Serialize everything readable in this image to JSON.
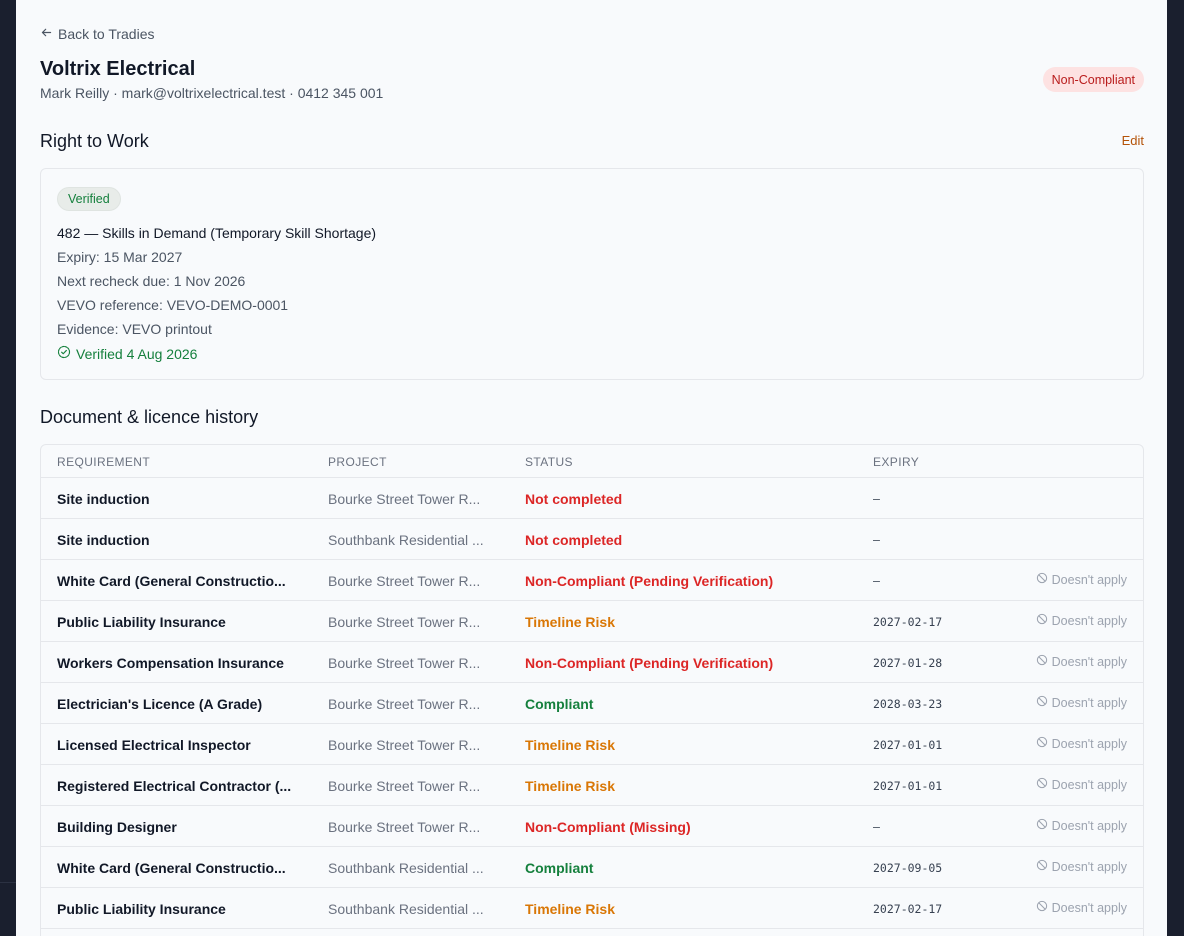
{
  "back_label": "Back to Tradies",
  "tradie": {
    "name": "Voltrix Electrical",
    "meta": "Mark Reilly · mark@voltrixelectrical.test · 0412 345 001",
    "status": "Non-Compliant"
  },
  "rtw": {
    "heading": "Right to Work",
    "edit_label": "Edit",
    "badge": "Verified",
    "visa": "482 — Skills in Demand (Temporary Skill Shortage)",
    "expiry": "Expiry: 15 Mar 2027",
    "recheck": "Next recheck due: 1 Nov 2026",
    "vevo_ref": "VEVO reference: VEVO-DEMO-0001",
    "evidence": "Evidence: VEVO printout",
    "verified_on": "Verified 4 Aug 2026"
  },
  "history": {
    "heading": "Document & licence history",
    "columns": [
      "REQUIREMENT",
      "PROJECT",
      "STATUS",
      "EXPIRY"
    ],
    "rows": [
      {
        "requirement": "Site induction",
        "project": "Bourke Street Tower R...",
        "status": "Not completed",
        "status_color": "red",
        "expiry": "–",
        "action": ""
      },
      {
        "requirement": "Site induction",
        "project": "Southbank Residential ...",
        "status": "Not completed",
        "status_color": "red",
        "expiry": "–",
        "action": ""
      },
      {
        "requirement": "White Card (General Constructio...",
        "project": "Bourke Street Tower R...",
        "status": "Non-Compliant (Pending Verification)",
        "status_color": "red",
        "expiry": "–",
        "action": "Doesn't apply"
      },
      {
        "requirement": "Public Liability Insurance",
        "project": "Bourke Street Tower R...",
        "status": "Timeline Risk",
        "status_color": "orange",
        "expiry": "2027-02-17",
        "action": "Doesn't apply"
      },
      {
        "requirement": "Workers Compensation Insurance",
        "project": "Bourke Street Tower R...",
        "status": "Non-Compliant (Pending Verification)",
        "status_color": "red",
        "expiry": "2027-01-28",
        "action": "Doesn't apply"
      },
      {
        "requirement": "Electrician's Licence (A Grade)",
        "project": "Bourke Street Tower R...",
        "status": "Compliant",
        "status_color": "green",
        "expiry": "2028-03-23",
        "action": "Doesn't apply"
      },
      {
        "requirement": "Licensed Electrical Inspector",
        "project": "Bourke Street Tower R...",
        "status": "Timeline Risk",
        "status_color": "orange",
        "expiry": "2027-01-01",
        "action": "Doesn't apply"
      },
      {
        "requirement": "Registered Electrical Contractor (...",
        "project": "Bourke Street Tower R...",
        "status": "Timeline Risk",
        "status_color": "orange",
        "expiry": "2027-01-01",
        "action": "Doesn't apply"
      },
      {
        "requirement": "Building Designer",
        "project": "Bourke Street Tower R...",
        "status": "Non-Compliant (Missing)",
        "status_color": "red",
        "expiry": "–",
        "action": "Doesn't apply"
      },
      {
        "requirement": "White Card (General Constructio...",
        "project": "Southbank Residential ...",
        "status": "Compliant",
        "status_color": "green",
        "expiry": "2027-09-05",
        "action": "Doesn't apply"
      },
      {
        "requirement": "Public Liability Insurance",
        "project": "Southbank Residential ...",
        "status": "Timeline Risk",
        "status_color": "orange",
        "expiry": "2027-02-17",
        "action": "Doesn't apply"
      }
    ]
  },
  "icons": {
    "back": "arrow-left-icon",
    "verified": "check-circle-icon",
    "not_applicable": "ban-icon"
  },
  "colors": {
    "red": "#dc2626",
    "orange": "#d97706",
    "green": "#15803d",
    "accent": "#b45309"
  }
}
